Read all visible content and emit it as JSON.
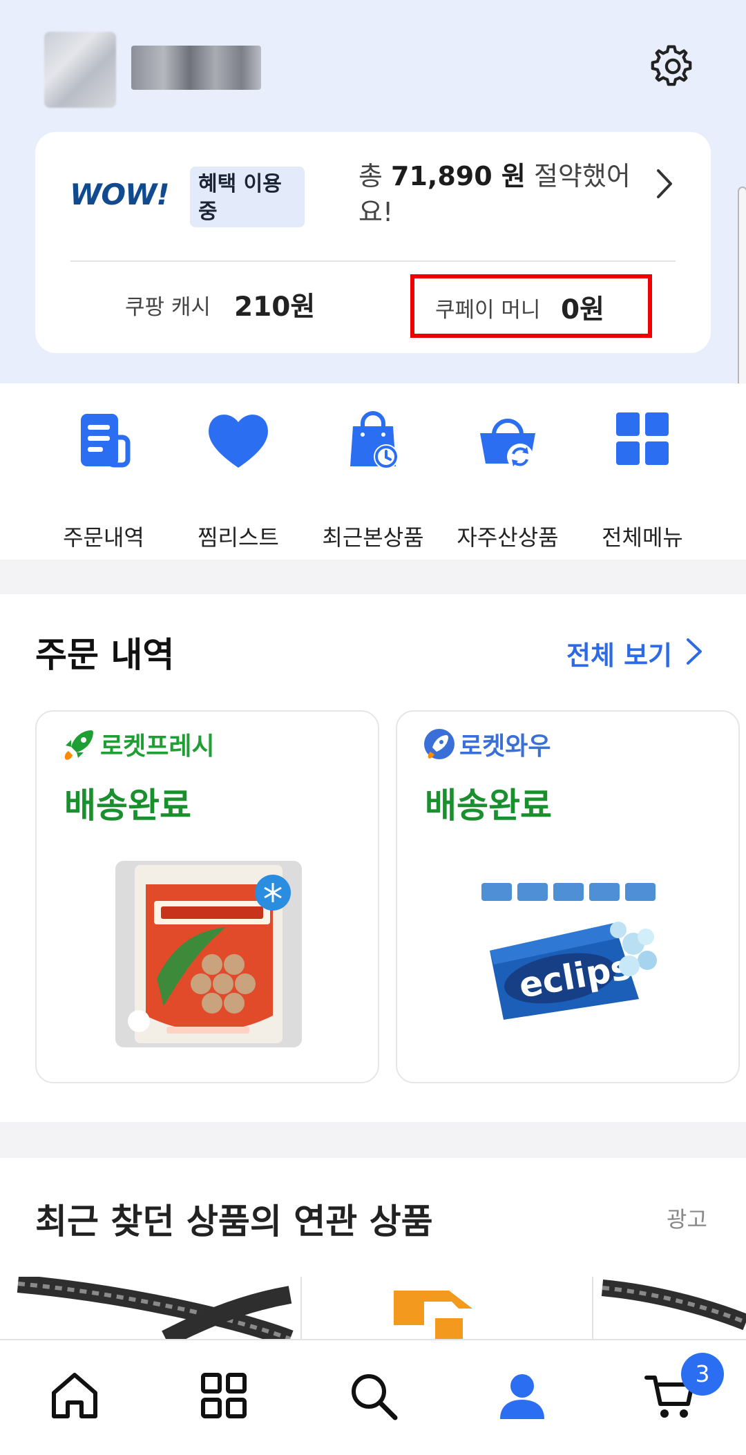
{
  "colors": {
    "accent_blue": "#2d6ae3",
    "brand_blue": "#124a8f",
    "delivered_green": "#1a8f2e",
    "highlight_red": "#ee0000",
    "header_bg": "#e8eefc"
  },
  "header": {
    "settings_icon": "gear-icon"
  },
  "wow": {
    "logo": "WOW!",
    "badge": "혜택 이용 중",
    "saved_prefix": "총 ",
    "saved_amount": "71,890 원",
    "saved_suffix": " 절약했어요!",
    "coupang_cash_label": "쿠팡 캐시",
    "coupang_cash_value": "210원",
    "coupay_money_label": "쿠페이 머니",
    "coupay_money_value": "0원"
  },
  "quick_menu": [
    {
      "label": "주문내역",
      "icon": "receipt-icon"
    },
    {
      "label": "찜리스트",
      "icon": "heart-icon"
    },
    {
      "label": "최근본상품",
      "icon": "shopping-bag-clock-icon"
    },
    {
      "label": "자주산상품",
      "icon": "basket-refresh-icon"
    },
    {
      "label": "전체메뉴",
      "icon": "grid-icon"
    }
  ],
  "orders": {
    "title": "주문 내역",
    "view_all": "전체 보기",
    "cards": [
      {
        "service": "로켓프레시",
        "status": "배송완료",
        "product": "dumpling-package-image"
      },
      {
        "service": "로켓와우",
        "status": "배송완료",
        "product": "eclipse-mint-image"
      }
    ]
  },
  "related": {
    "title": "최근 찾던 상품의 연관 상품",
    "ad_label": "광고"
  },
  "bottom_nav": {
    "items": [
      "home-icon",
      "category-icon",
      "search-icon",
      "my-coupang-icon",
      "cart-icon"
    ],
    "cart_count": "3"
  }
}
